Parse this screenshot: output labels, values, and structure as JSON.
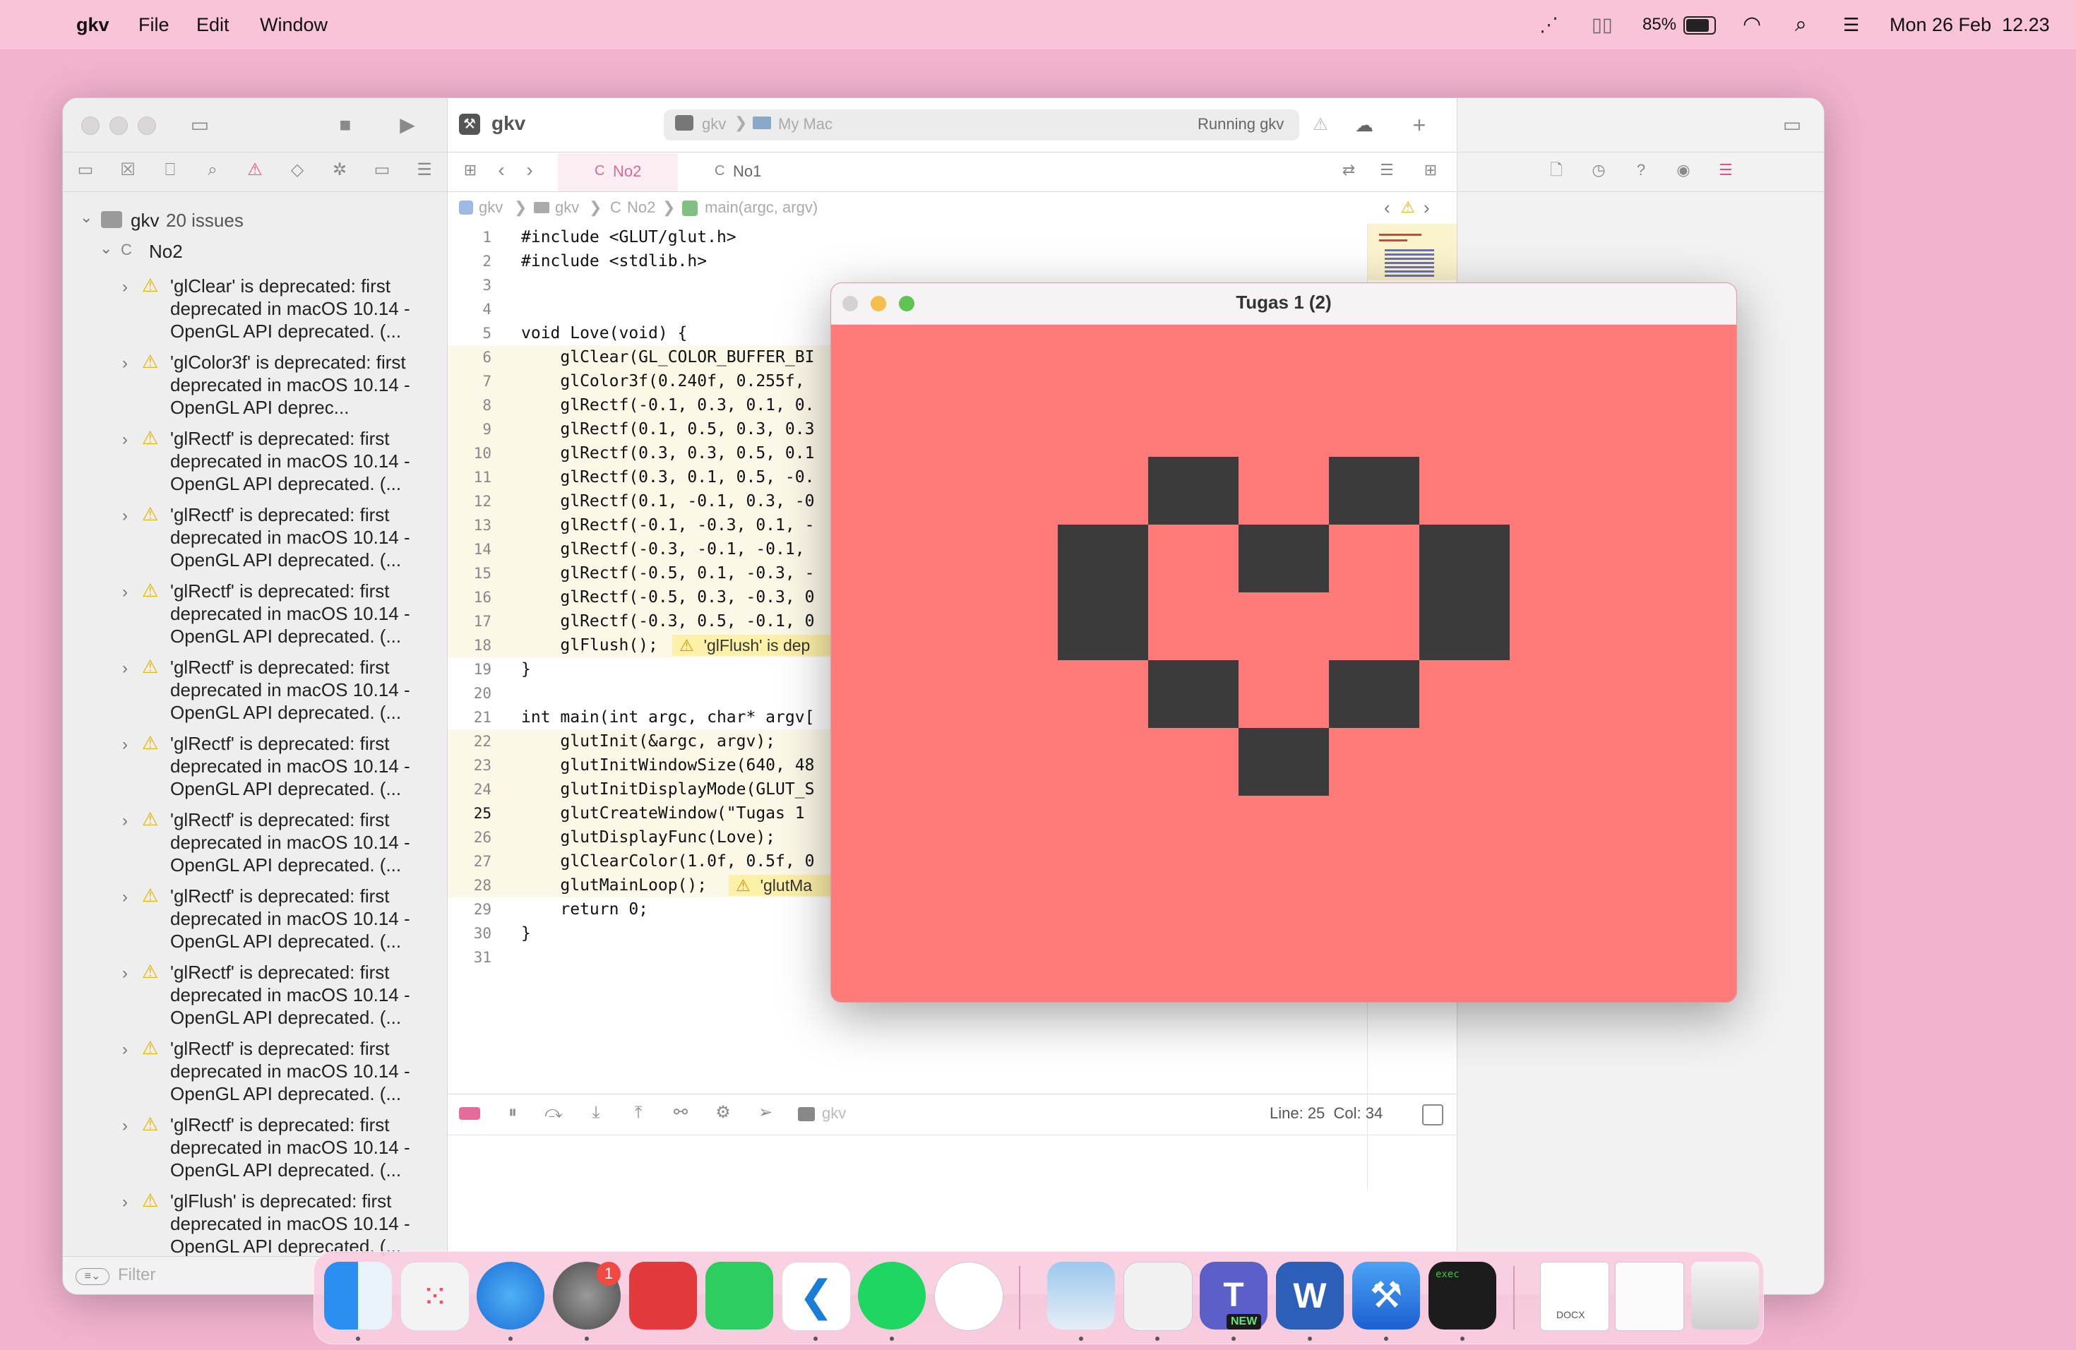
{
  "menubar": {
    "app_name": "gkv",
    "items": [
      "File",
      "Edit",
      "Window"
    ],
    "battery": "85%",
    "datetime": "Mon 26 Feb  12.23"
  },
  "xcode": {
    "project": "gkv",
    "scheme": "gkv",
    "destination": "My Mac",
    "status": "Running gkv",
    "tabs": [
      {
        "label": "No2",
        "active": true
      },
      {
        "label": "No1",
        "active": false
      }
    ],
    "breadcrumb": [
      "gkv",
      "gkv",
      "No2",
      "main(argc, argv)"
    ],
    "navigator": {
      "root_label": "gkv",
      "issue_count": "20 issues",
      "file": "No2",
      "issues": [
        "'glClear' is deprecated: first deprecated in macOS 10.14 - OpenGL API deprecated. (...",
        "'glColor3f' is deprecated: first deprecated in macOS 10.14 - OpenGL API deprec...",
        "'glRectf' is deprecated: first deprecated in macOS 10.14 - OpenGL API deprecated. (...",
        "'glRectf' is deprecated: first deprecated in macOS 10.14 - OpenGL API deprecated. (...",
        "'glRectf' is deprecated: first deprecated in macOS 10.14 - OpenGL API deprecated. (...",
        "'glRectf' is deprecated: first deprecated in macOS 10.14 - OpenGL API deprecated. (...",
        "'glRectf' is deprecated: first deprecated in macOS 10.14 - OpenGL API deprecated. (...",
        "'glRectf' is deprecated: first deprecated in macOS 10.14 - OpenGL API deprecated. (...",
        "'glRectf' is deprecated: first deprecated in macOS 10.14 - OpenGL API deprecated. (...",
        "'glRectf' is deprecated: first deprecated in macOS 10.14 - OpenGL API deprecated. (...",
        "'glRectf' is deprecated: first deprecated in macOS 10.14 - OpenGL API deprecated. (...",
        "'glRectf' is deprecated: first deprecated in macOS 10.14 - OpenGL API deprecated. (...",
        "'glFlush' is deprecated: first deprecated in macOS 10.14 - OpenGL API deprecated. (..."
      ],
      "filter_placeholder": "Filter"
    },
    "code_lines": [
      "#include <GLUT/glut.h>",
      "#include <stdlib.h>",
      "",
      "",
      "void Love(void) {",
      "    glClear(GL_COLOR_BUFFER_BI",
      "    glColor3f(0.240f, 0.255f,",
      "    glRectf(-0.1, 0.3, 0.1, 0.",
      "    glRectf(0.1, 0.5, 0.3, 0.3",
      "    glRectf(0.3, 0.3, 0.5, 0.1",
      "    glRectf(0.3, 0.1, 0.5, -0.",
      "    glRectf(0.1, -0.1, 0.3, -0",
      "    glRectf(-0.1, -0.3, 0.1, -",
      "    glRectf(-0.3, -0.1, -0.1,",
      "    glRectf(-0.5, 0.1, -0.3, -",
      "    glRectf(-0.5, 0.3, -0.3, 0",
      "    glRectf(-0.3, 0.5, -0.1, 0",
      "    glFlush();",
      "}",
      "",
      "int main(int argc, char* argv[",
      "    glutInit(&argc, argv);",
      "    glutInitWindowSize(640, 48",
      "    glutInitDisplayMode(GLUT_S",
      "    glutCreateWindow(\"Tugas 1",
      "    glutDisplayFunc(Love);",
      "    glClearColor(1.0f, 0.5f, 0",
      "    glutMainLoop();",
      "    return 0;",
      "}",
      ""
    ],
    "inline_warnings": {
      "line18": "'glFlush' is dep",
      "line28": "'glutMa"
    },
    "statusbar": {
      "target": "gkv",
      "position": "Line: 25  Col: 34"
    }
  },
  "glut_window": {
    "title": "Tugas 1 (2)",
    "background": "#ff7b79",
    "pixel_color": "#3b3b3b"
  },
  "dock": {
    "teams_badge": "NEW",
    "settings_badge": "1",
    "terminal_text": "exec",
    "doc_label": "DOCX"
  }
}
